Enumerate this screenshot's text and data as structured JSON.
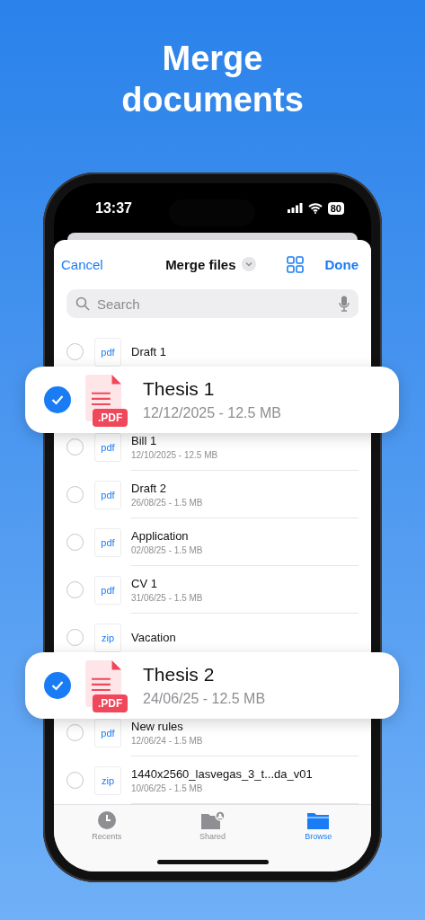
{
  "headline": "Merge documents",
  "status_bar": {
    "time": "13:37",
    "battery": "80"
  },
  "header": {
    "cancel": "Cancel",
    "title": "Merge files",
    "done": "Done"
  },
  "search": {
    "placeholder": "Search"
  },
  "files": [
    {
      "type": "pdf",
      "name": "Draft 1",
      "selected": false
    },
    {
      "badge": ".PDF",
      "name": "Thesis 1",
      "meta": "12/12/2025 - 12.5 MB",
      "selected": true
    },
    {
      "type": "pdf",
      "name": "Bill 1",
      "meta": "12/10/2025 - 12.5 MB",
      "selected": false
    },
    {
      "type": "pdf",
      "name": "Draft 2",
      "meta": "26/08/25 - 1.5 MB",
      "selected": false
    },
    {
      "type": "pdf",
      "name": "Application",
      "meta": "02/08/25 - 1.5 MB",
      "selected": false
    },
    {
      "type": "pdf",
      "name": "CV 1",
      "meta": "31/06/25 - 1.5 MB",
      "selected": false
    },
    {
      "type": "zip",
      "name": "Vacation",
      "selected": false
    },
    {
      "badge": ".PDF",
      "name": "Thesis 2",
      "meta": "24/06/25 - 12.5 MB",
      "selected": true
    },
    {
      "type": "pdf",
      "name": "New rules",
      "meta": "12/06/24 - 1.5 MB",
      "selected": false
    },
    {
      "type": "zip",
      "name": "1440x2560_lasvegas_3_t...da_v01",
      "meta": "10/06/25 - 1.5 MB",
      "selected": false
    }
  ],
  "tabs": [
    {
      "kind": "recents",
      "label": "Recents",
      "selected": false
    },
    {
      "kind": "shared",
      "label": "Shared",
      "selected": false
    },
    {
      "kind": "browse",
      "label": "Browse",
      "selected": true
    }
  ]
}
